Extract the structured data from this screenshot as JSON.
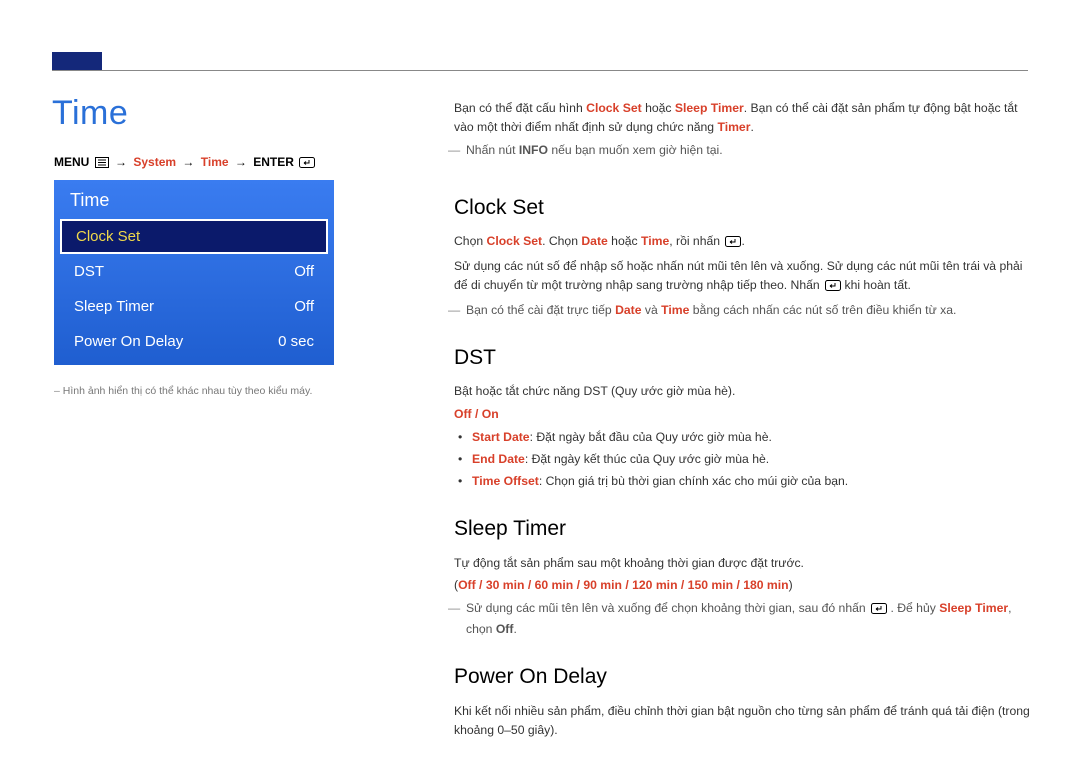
{
  "pageTitle": "Time",
  "breadcrumb": {
    "menu": "MENU",
    "system": "System",
    "time": "Time",
    "enter": "ENTER"
  },
  "panel": {
    "title": "Time",
    "items": [
      {
        "label": "Clock Set",
        "value": "",
        "selected": true
      },
      {
        "label": "DST",
        "value": "Off"
      },
      {
        "label": "Sleep Timer",
        "value": "Off"
      },
      {
        "label": "Power On Delay",
        "value": "0 sec"
      }
    ]
  },
  "imgNote": "Hình ảnh hiển thị có thể khác nhau tùy theo kiểu máy.",
  "intro": {
    "p1a": "Bạn có thể đặt cấu hình ",
    "p1b": "Clock Set",
    "p1c": " hoặc ",
    "p1d": "Sleep Timer",
    "p1e": ". Bạn có thể cài đặt sản phẩm tự động bật hoặc tắt vào một thời điểm nhất định sử dụng chức năng ",
    "p1f": "Timer",
    "p1g": ".",
    "note1a": "Nhấn nút ",
    "note1b": "INFO",
    "note1c": " nếu bạn muốn xem giờ hiện tại."
  },
  "clockSet": {
    "h": "Clock Set",
    "p1a": "Chọn ",
    "p1b": "Clock Set",
    "p1c": ". Chọn ",
    "p1d": "Date",
    "p1e": " hoặc ",
    "p1f": "Time",
    "p1g": ", rồi nhấn ",
    "p2": "Sử dụng các nút số để nhập số hoặc nhấn nút mũi tên lên và xuống. Sử dụng các nút mũi tên trái và phải để di chuyển từ một trường nhập sang trường nhập tiếp theo. Nhấn ",
    "p2b": " khi hoàn tất.",
    "noteA": "Bạn có thể cài đặt trực tiếp ",
    "noteB": "Date",
    "noteC": " và ",
    "noteD": "Time",
    "noteE": " bằng cách nhấn các nút số trên điều khiển từ xa."
  },
  "dst": {
    "h": "DST",
    "p1": "Bật hoặc tắt chức năng DST (Quy ước giờ mùa hè).",
    "opts": "Off / On",
    "b1a": "Start Date",
    "b1b": ": Đặt ngày bắt đầu của Quy ước giờ mùa hè.",
    "b2a": "End Date",
    "b2b": ": Đặt ngày kết thúc của Quy ước giờ mùa hè.",
    "b3a": "Time Offset",
    "b3b": ": Chọn giá trị bù thời gian chính xác cho múi giờ của bạn."
  },
  "sleepTimer": {
    "h": "Sleep Timer",
    "p1": "Tự động tắt sản phẩm sau một khoảng thời gian được đặt trước.",
    "opts": "Off / 30 min / 60 min / 90 min / 120 min / 150 min / 180 min",
    "noteA": "Sử dụng các mũi tên lên và xuống để chọn khoảng thời gian, sau đó nhấn ",
    "noteB": ". Để hủy ",
    "noteC": "Sleep Timer",
    "noteD": ", chọn ",
    "noteE": "Off",
    "noteF": "."
  },
  "powerOnDelay": {
    "h": "Power On Delay",
    "p1": "Khi kết nối nhiều sản phẩm, điều chỉnh thời gian bật nguồn cho từng sản phẩm để tránh quá tải điện (trong khoảng 0–50 giây)."
  }
}
